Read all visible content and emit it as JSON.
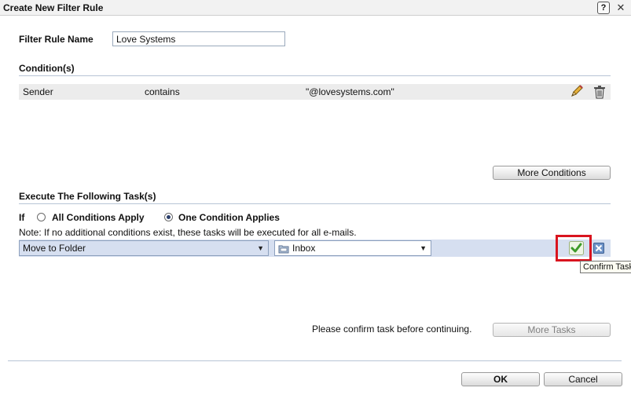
{
  "dialog": {
    "title": "Create New Filter Rule",
    "help_glyph": "?",
    "close_glyph": "✕"
  },
  "rule_name": {
    "label": "Filter Rule Name",
    "value": "Love Systems"
  },
  "conditions": {
    "heading": "Condition(s)",
    "rows": [
      {
        "field": "Sender",
        "operator": "contains",
        "value": "\"@lovesystems.com\""
      }
    ],
    "more_button": "More Conditions"
  },
  "tasks": {
    "heading": "Execute The Following Task(s)",
    "if_label": "If",
    "option_all": "All Conditions Apply",
    "option_one": "One Condition Applies",
    "selected_option": "One Condition Applies",
    "note": "Note: If no additional conditions exist, these tasks will be executed for all e-mails.",
    "action_select": "Move to Folder",
    "folder_select": "Inbox",
    "tooltip": "Confirm Task",
    "confirm_message": "Please confirm task before continuing.",
    "more_button": "More Tasks"
  },
  "footer": {
    "ok": "OK",
    "cancel": "Cancel"
  },
  "colors": {
    "highlight": "#d9141f",
    "task_row": "#d6dff0",
    "condition_row": "#ececec"
  },
  "icons": [
    "help-icon",
    "close-icon",
    "pencil-icon",
    "trash-icon",
    "folder-icon",
    "checkmark-icon",
    "cancel-x-icon",
    "dropdown-arrow-icon"
  ]
}
